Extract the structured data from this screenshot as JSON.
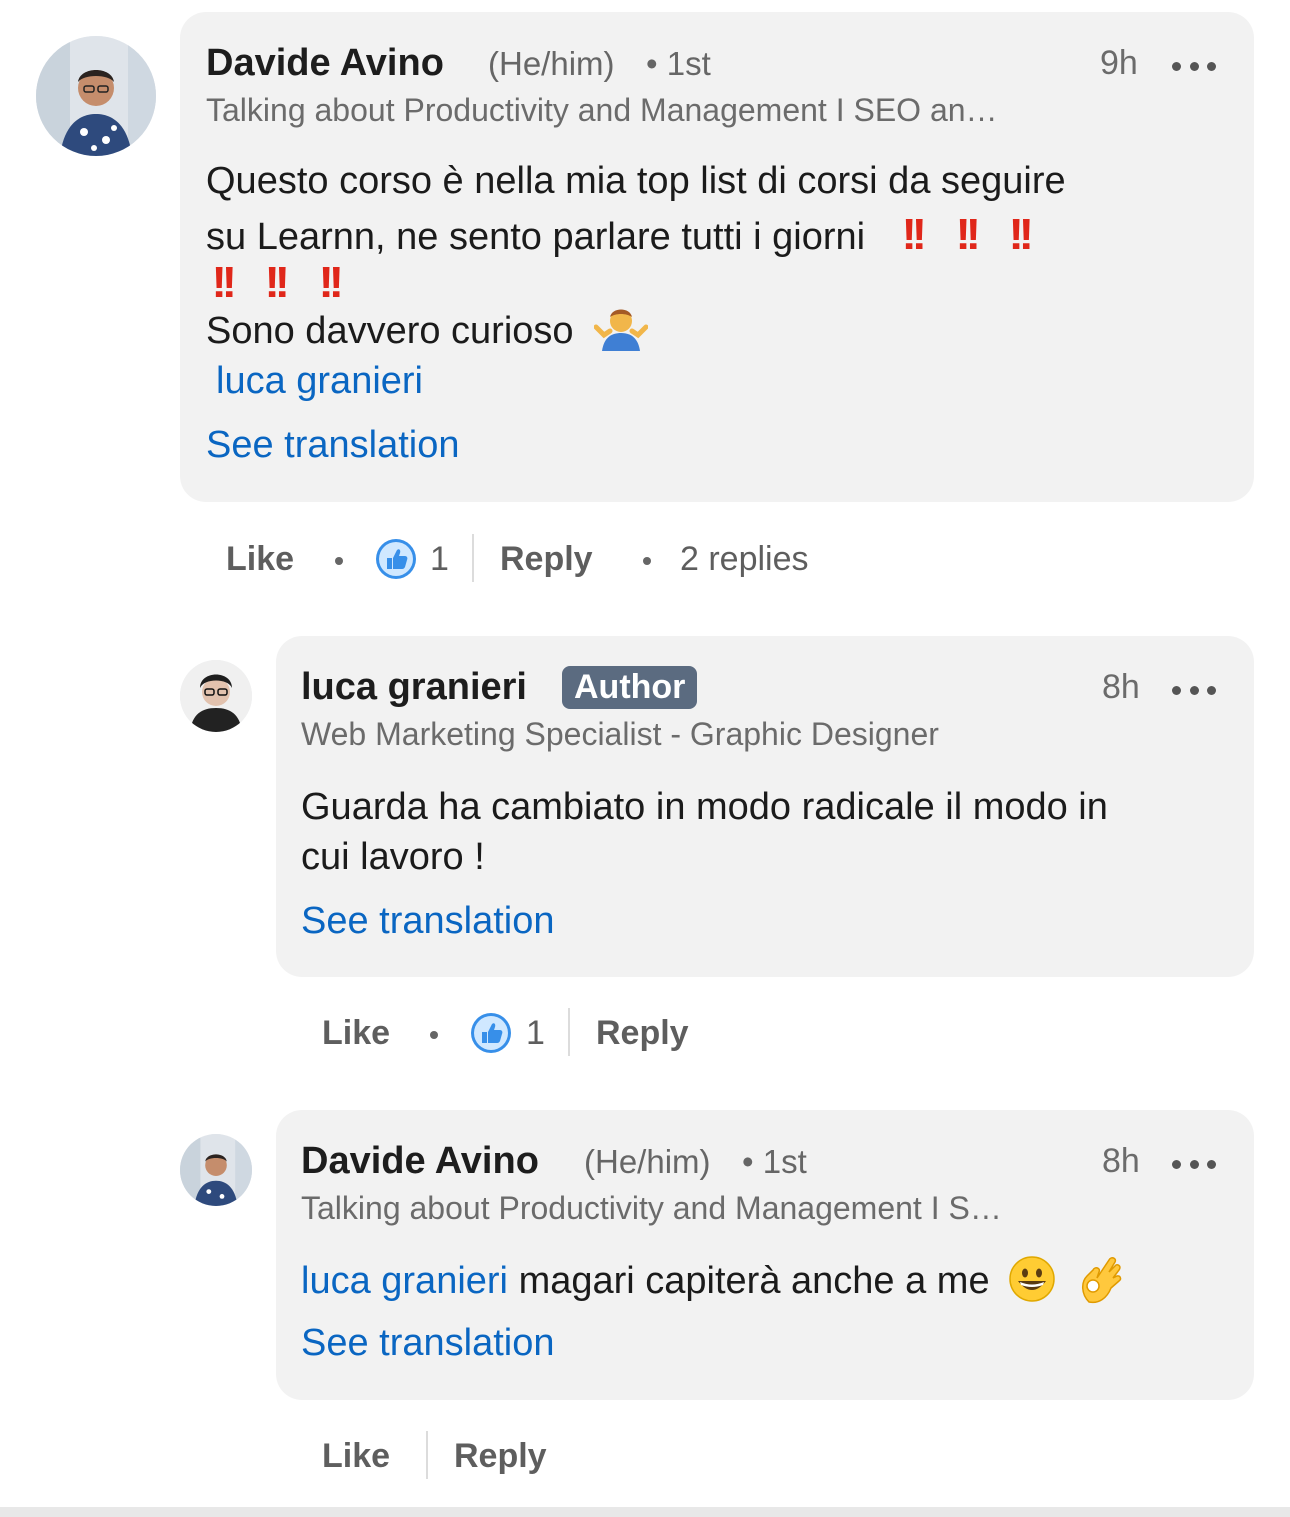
{
  "comment": {
    "author": "Davide Avino",
    "pronouns": "(He/him)",
    "degree": "• 1st",
    "headline": "Talking about Productivity and Management I SEO an…",
    "time": "9h",
    "line1": "Questo corso è nella mia top list di corsi da seguire",
    "line2": "su Learnn, ne sento parlare tutti i giorni",
    "line4": "Sono davvero curioso",
    "mention": "luca granieri",
    "see_translation": "See translation",
    "actions": {
      "like": "Like",
      "like_count": "1",
      "reply": "Reply",
      "replies": "2 replies"
    }
  },
  "reply1": {
    "author": "luca granieri",
    "badge": "Author",
    "headline": "Web Marketing Specialist - Graphic Designer",
    "time": "8h",
    "line1": "Guarda ha cambiato in modo radicale il modo in",
    "line2": "cui lavoro !",
    "see_translation": "See translation",
    "actions": {
      "like": "Like",
      "like_count": "1",
      "reply": "Reply"
    }
  },
  "reply2": {
    "author": "Davide Avino",
    "pronouns": "(He/him)",
    "degree": "• 1st",
    "headline": "Talking about Productivity and Management I S…",
    "time": "8h",
    "mention": "luca granieri",
    "text": "magari capiterà anche a me",
    "see_translation": "See translation",
    "actions": {
      "like": "Like",
      "reply": "Reply"
    }
  },
  "colors": {
    "link": "#0a66c2",
    "bubble": "#f2f2f2",
    "badge": "#5b6b80",
    "exclamation": "#e0271a"
  },
  "icons": {
    "more": "more-horizontal-icon",
    "like": "thumbs-up-reaction-icon",
    "shrug": "person-shrugging-emoji",
    "grin": "grinning-face-emoji",
    "ok": "ok-hand-emoji",
    "double_exclamation": "double-exclamation-emoji"
  }
}
